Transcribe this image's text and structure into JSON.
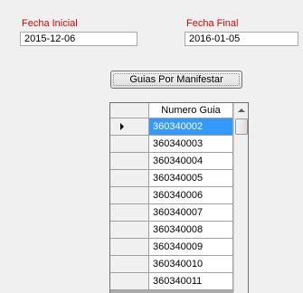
{
  "filters": {
    "start_label": "Fecha Inicial",
    "start_value": "2015-12-06",
    "end_label": "Fecha Final",
    "end_value": "2016-01-05"
  },
  "button": {
    "label": "Guias Por Manifestar"
  },
  "grid": {
    "column_header": "Numero Guia",
    "rows": [
      "360340002",
      "360340003",
      "360340004",
      "360340005",
      "360340006",
      "360340007",
      "360340008",
      "360340009",
      "360340010",
      "360340011"
    ],
    "selected_index": 0
  },
  "colors": {
    "label": "#e00000",
    "selection": "#3399ff"
  }
}
